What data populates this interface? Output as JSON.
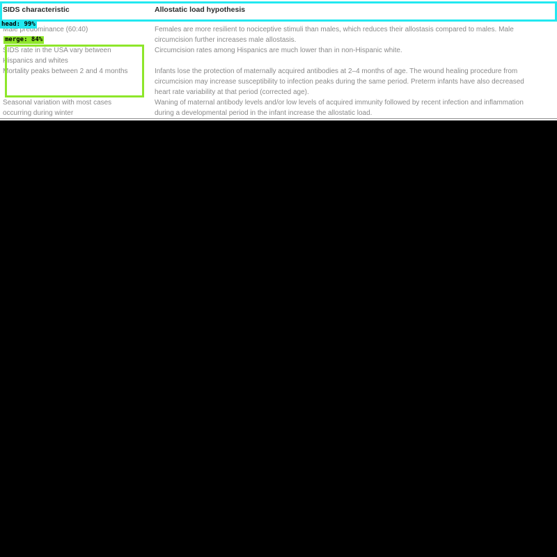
{
  "table": {
    "headers": [
      "SIDS characteristic",
      "Allostatic load hypothesis"
    ],
    "rows": [
      {
        "characteristic": [
          "Male predominance (60:40)"
        ],
        "hypothesis": [
          "Females are more resilient to nociceptive stimuli than males, which reduces their allostasis compared to males. Male",
          "circumcision further increases male allostasis."
        ]
      },
      {
        "characteristic": [
          "SIDS rate in the USA vary between",
          "Hispanics and whites"
        ],
        "hypothesis": [
          "Circumcision rates among Hispanics are much lower than in non-Hispanic white."
        ]
      },
      {
        "characteristic": [
          "Mortality peaks between 2 and 4 months"
        ],
        "hypothesis": [
          "Infants lose the protection of maternally acquired antibodies at 2–4 months of age. The wound healing procedure from",
          "circumcision may increase susceptibility to infection peaks during the same period. Preterm infants have also decreased",
          "heart rate variability at that period (corrected age)."
        ]
      },
      {
        "characteristic": [
          "Seasonal variation with most cases",
          "occurring during winter"
        ],
        "hypothesis": [
          "Waning of maternal antibody levels and/or low levels of acquired immunity followed by recent infection and inflammation",
          "during a developmental period in the infant increase the allostatic load."
        ]
      }
    ]
  },
  "detections": {
    "head": {
      "label": "head: 99%",
      "color": "#22e8f0"
    },
    "merge": {
      "label": "merge: 84%",
      "color": "#8ee62a"
    }
  }
}
